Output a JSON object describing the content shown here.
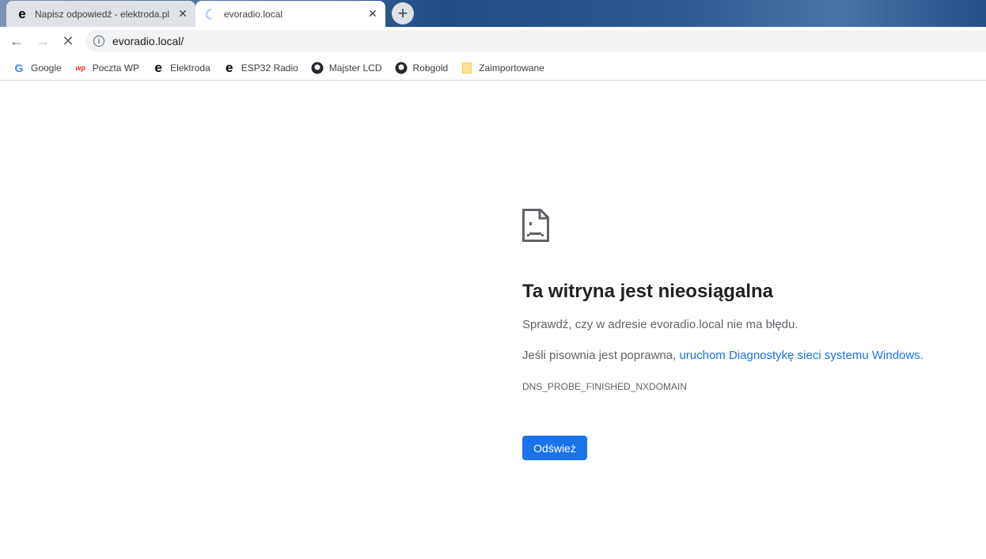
{
  "tabs": [
    {
      "title": "Napisz odpowiedź - elektroda.pl",
      "icon": "elektroda-icon",
      "active": false
    },
    {
      "title": "evoradio.local",
      "icon": "loading-spinner-icon",
      "active": true
    }
  ],
  "toolbar": {
    "url": "evoradio.local/"
  },
  "bookmarks": [
    {
      "label": "Google",
      "icon": "google-icon"
    },
    {
      "label": "Poczta WP",
      "icon": "wp-icon"
    },
    {
      "label": "Elektroda",
      "icon": "elektroda-icon"
    },
    {
      "label": "ESP32 Radio",
      "icon": "elektroda-icon"
    },
    {
      "label": "Majster LCD",
      "icon": "github-icon"
    },
    {
      "label": "Robgold",
      "icon": "github-icon"
    },
    {
      "label": "Zaimportowane",
      "icon": "folder-icon"
    }
  ],
  "error": {
    "title": "Ta witryna jest nieosiągalna",
    "line1": "Sprawdź, czy w adresie evoradio.local nie ma błędu.",
    "line2_prefix": "Jeśli pisownia jest poprawna, ",
    "line2_link": "uruchom Diagnostykę sieci systemu Windows",
    "line2_suffix": ".",
    "code": "DNS_PROBE_FINISHED_NXDOMAIN",
    "reload": "Odśwież"
  },
  "colors": {
    "accent": "#1a73e8"
  }
}
